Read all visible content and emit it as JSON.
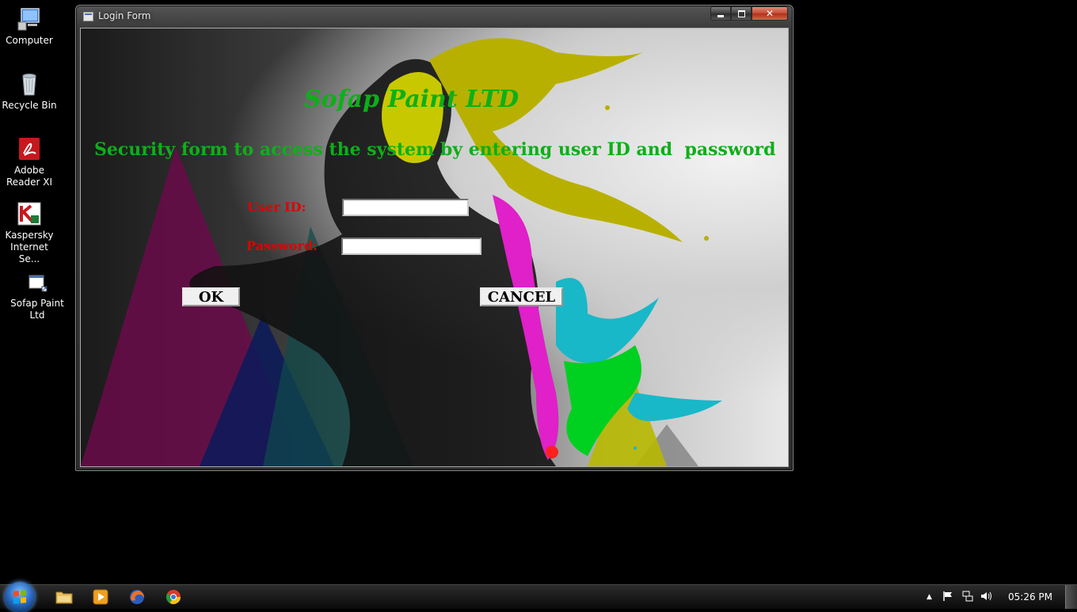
{
  "desktop": {
    "icons": [
      {
        "label": "Computer",
        "icon": "computer-icon"
      },
      {
        "label": "Recycle Bin",
        "icon": "recycle-bin-icon"
      },
      {
        "label": "Adobe Reader XI",
        "icon": "adobe-reader-icon"
      },
      {
        "label": "Kaspersky Internet Se...",
        "icon": "kaspersky-icon"
      },
      {
        "label": "Sofap Paint Ltd",
        "icon": "program-shortcut-icon"
      }
    ]
  },
  "window": {
    "title": "Login Form",
    "controls": {
      "minimize": "minimize-icon",
      "maximize": "maximize-icon",
      "close_label": "✕"
    }
  },
  "form": {
    "company_name": "Sofap Paint LTD",
    "subtitle": "Security form to access the system by entering user ID and  password",
    "user_id_label": "User ID:",
    "user_id_value": "",
    "password_label": "Password:",
    "password_value": "",
    "ok_label": "OK",
    "cancel_label": "CANCEL",
    "colors": {
      "title": "#0cb018",
      "labels": "#e00000"
    }
  },
  "taskbar": {
    "pinned": [
      "windows-explorer-icon",
      "media-player-icon",
      "firefox-icon",
      "chrome-icon"
    ],
    "tray_icons": [
      "show-hidden-icons-arrow",
      "action-center-flag-icon",
      "network-icon",
      "volume-icon"
    ],
    "clock": "05:26 PM"
  }
}
